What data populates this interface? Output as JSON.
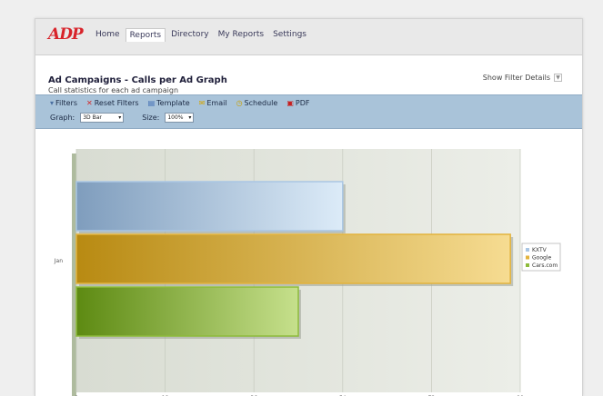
{
  "brand": "ADP",
  "nav": {
    "items": [
      {
        "label": "Home",
        "active": false
      },
      {
        "label": "Reports",
        "active": true
      },
      {
        "label": "Directory",
        "active": false
      },
      {
        "label": "My Reports",
        "active": false
      },
      {
        "label": "Settings",
        "active": false
      }
    ]
  },
  "page": {
    "title": "Ad Campaigns - Calls per Ad Graph",
    "subtitle": "Call statistics for each ad campaign",
    "show_filter_label": "Show Filter Details"
  },
  "toolbar": {
    "buttons": [
      {
        "label": "Filters",
        "icon": "filter-icon",
        "glyph": "▾",
        "color": "#4a6fa0"
      },
      {
        "label": "Reset Filters",
        "icon": "reset-icon",
        "glyph": "✕",
        "color": "#d12b2b"
      },
      {
        "label": "Template",
        "icon": "template-icon",
        "glyph": "▤",
        "color": "#3d6bb3"
      },
      {
        "label": "Email",
        "icon": "email-icon",
        "glyph": "✉",
        "color": "#d4a400"
      },
      {
        "label": "Schedule",
        "icon": "schedule-icon",
        "glyph": "◷",
        "color": "#c9a000"
      },
      {
        "label": "PDF",
        "icon": "pdf-icon",
        "glyph": "▣",
        "color": "#c62020"
      }
    ],
    "graph_label": "Graph:",
    "graph_value": "3D Bar",
    "size_label": "Size:",
    "size_value": "100%"
  },
  "chart_data": {
    "type": "bar",
    "orientation": "horizontal",
    "categories": [
      "Jan"
    ],
    "series": [
      {
        "name": "KXTV",
        "values": [
          54
        ],
        "color": "#a9c6e4"
      },
      {
        "name": "Google",
        "values": [
          88
        ],
        "color": "#e3b33c"
      },
      {
        "name": "Cars.com",
        "values": [
          45
        ],
        "color": "#8dbb3a"
      }
    ],
    "xlim": [
      0,
      90
    ],
    "xticks": [
      "0",
      "18",
      "36",
      "54",
      "72",
      "90"
    ],
    "grid": true,
    "legend_position": "right"
  }
}
